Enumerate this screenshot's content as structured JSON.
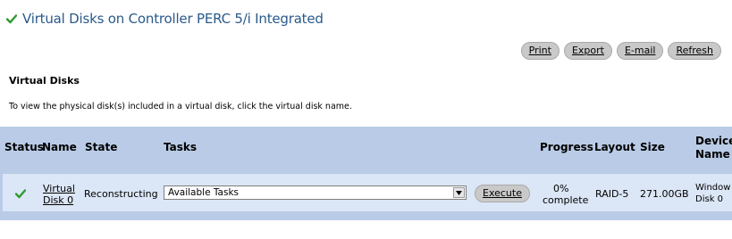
{
  "page": {
    "title": "Virtual Disks on Controller PERC 5/i Integrated",
    "status_icon": "check-icon",
    "accent_color": "#2a5a8a"
  },
  "toolbar": {
    "print_label": "Print",
    "export_label": "Export",
    "email_label": "E-mail",
    "refresh_label": "Refresh"
  },
  "section": {
    "title": "Virtual Disks",
    "hint": "To view the physical disk(s) included in a virtual disk, click the virtual disk name."
  },
  "table": {
    "headers": {
      "status": "Status",
      "name": "Name",
      "state": "State",
      "tasks": "Tasks",
      "progress": "Progress",
      "layout": "Layout",
      "size": "Size",
      "device_line1": "Device",
      "device_line2": "Name"
    },
    "row": {
      "status_icon": "check-icon",
      "name_line1": "Virtual",
      "name_line2": "Disk 0",
      "state": "Reconstructing",
      "tasks_selected": "Available Tasks",
      "execute_label": "Execute",
      "progress_line1": "0%",
      "progress_line2": "complete",
      "layout": "RAID-5",
      "size": "271.00GB",
      "device_line1": "Window",
      "device_line2": "Disk 0"
    }
  }
}
